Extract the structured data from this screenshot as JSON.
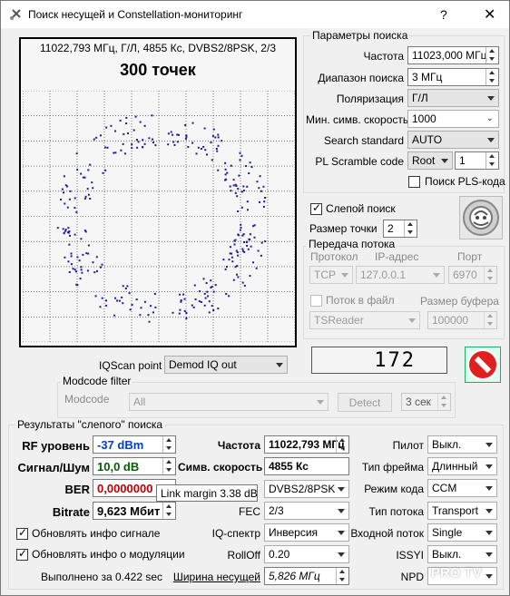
{
  "window": {
    "title": "Поиск несущей и Constellation-мониторинг",
    "help": "?",
    "close": "✕"
  },
  "constellation": {
    "header": "11022,793 МГц, Г/Л, 4855 Кс, DVBS2/8PSK, 2/3",
    "points_label": "300 точек",
    "point_color": "#1a1aa0"
  },
  "search_params": {
    "title": "Параметры поиска",
    "frequency_label": "Частота",
    "frequency_value": "11023,000 МГц",
    "range_label": "Диапазон поиска",
    "range_value": "3 МГц",
    "polarization_label": "Поляризация",
    "polarization_value": "Г/Л",
    "min_sr_label": "Мин. симв. скорость",
    "min_sr_value": "1000",
    "standard_label": "Search standard",
    "standard_value": "AUTO",
    "pls_label": "PL Scramble code",
    "pls_mode": "Root",
    "pls_value": "1",
    "pls_search_label": "Поиск PLS-кода"
  },
  "blind": {
    "label": "Слепой поиск",
    "point_size_label": "Размер точки",
    "point_size_value": "2"
  },
  "stream": {
    "title": "Передача потока",
    "protocol_label": "Протокол",
    "ip_label": "IP-адрес",
    "port_label": "Порт",
    "protocol_value": "TCP",
    "ip_value": "127.0.0.1",
    "port_value": "6970",
    "tofile_label": "Поток в файл",
    "buffer_label": "Размер буфера",
    "reader_value": "TSReader",
    "buffer_value": "100000"
  },
  "iqscan": {
    "label": "IQScan point",
    "value": "Demod IQ out",
    "lcd": "172"
  },
  "modcode": {
    "title": "Modcode filter",
    "label": "Modcode",
    "value": "All",
    "detect": "Detect",
    "timer": "3 сек"
  },
  "results": {
    "title": "Результаты \"слепого\" поиска",
    "rf_label": "RF уровень",
    "rf_value": "-37 dBm",
    "snr_label": "Сигнал/Шум",
    "snr_value": "10,0 dB",
    "ber_label": "BER",
    "ber_value": "0,0000000",
    "bitrate_label": "Bitrate",
    "bitrate_value": "9,623 Мбит",
    "tooltip": "Link margin 3.38 dB",
    "freq_label": "Частота",
    "freq_value": "11022,793 МГц",
    "sr_label": "Симв. скорость",
    "sr_value": "4855 Кс",
    "mod_value": "DVBS2/8PSK",
    "fec_label": "FEC",
    "fec_value": "2/3",
    "iq_label": "IQ-спектр",
    "iq_value": "Инверсия",
    "rolloff_label": "RollOff",
    "rolloff_value": "0.20",
    "bw_label": "Ширина несущей",
    "bw_value": "5,826 МГц",
    "pilot_label": "Пилот",
    "pilot_value": "Выкл.",
    "frame_label": "Тип фрейма",
    "frame_value": "Длинный",
    "code_label": "Режим кода",
    "code_value": "CCM",
    "stream_type_label": "Тип потока",
    "stream_type_value": "Transport",
    "input_label": "Входной поток",
    "input_value": "Single",
    "issyi_label": "ISSYI",
    "issyi_value": "Выкл.",
    "npd_label": "NPD",
    "update_signal": "Обновлять инфо сигнале",
    "update_mod": "Обновлять инфо о модуляции",
    "done": "Выполнено за 0.422 sec"
  },
  "watermark": "PRO TV"
}
